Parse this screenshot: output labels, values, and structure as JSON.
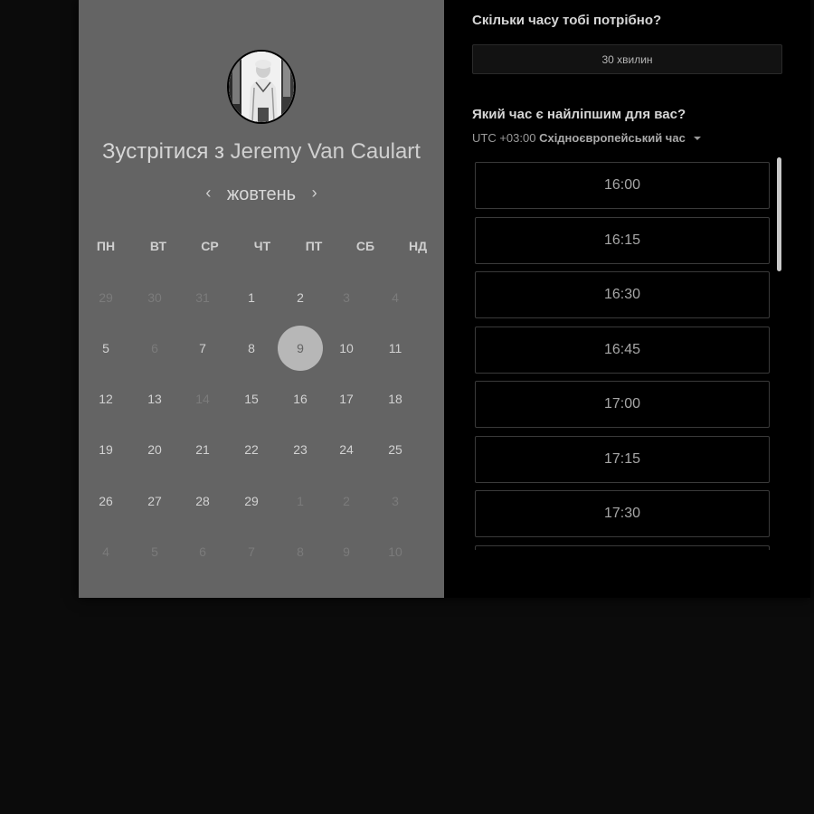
{
  "calendar": {
    "title_prefix": "Зустрітися з",
    "host_name": "Jeremy Van Caulart",
    "month": "жовтень",
    "prev_icon": "‹",
    "next_icon": "›",
    "weekdays": [
      "ПН",
      "ВТ",
      "СР",
      "ЧТ",
      "ПТ",
      "СБ",
      "НД"
    ],
    "weeks": [
      [
        {
          "d": "29",
          "m": true
        },
        {
          "d": "30",
          "m": true
        },
        {
          "d": "31",
          "m": true
        },
        {
          "d": "1",
          "m": false
        },
        {
          "d": "2",
          "m": false
        },
        {
          "d": "3",
          "m": true
        },
        {
          "d": "4",
          "m": true
        }
      ],
      [
        {
          "d": "5",
          "m": false
        },
        {
          "d": "6",
          "m": true
        },
        {
          "d": "7",
          "m": false
        },
        {
          "d": "8",
          "m": false
        },
        {
          "d": "9",
          "m": false,
          "sel": true
        },
        {
          "d": "10",
          "m": false
        },
        {
          "d": "11",
          "m": false
        }
      ],
      [
        {
          "d": "12",
          "m": false
        },
        {
          "d": "13",
          "m": false
        },
        {
          "d": "14",
          "m": true
        },
        {
          "d": "15",
          "m": false
        },
        {
          "d": "16",
          "m": false
        },
        {
          "d": "17",
          "m": false
        },
        {
          "d": "18",
          "m": false
        }
      ],
      [
        {
          "d": "19",
          "m": false
        },
        {
          "d": "20",
          "m": false
        },
        {
          "d": "21",
          "m": false
        },
        {
          "d": "22",
          "m": false
        },
        {
          "d": "23",
          "m": false
        },
        {
          "d": "24",
          "m": false
        },
        {
          "d": "25",
          "m": false
        }
      ],
      [
        {
          "d": "26",
          "m": false
        },
        {
          "d": "27",
          "m": false
        },
        {
          "d": "28",
          "m": false
        },
        {
          "d": "29",
          "m": false
        },
        {
          "d": "1",
          "m": true
        },
        {
          "d": "2",
          "m": true
        },
        {
          "d": "3",
          "m": true
        }
      ],
      [
        {
          "d": "4",
          "m": true
        },
        {
          "d": "5",
          "m": true
        },
        {
          "d": "6",
          "m": true
        },
        {
          "d": "7",
          "m": true
        },
        {
          "d": "8",
          "m": true
        },
        {
          "d": "9",
          "m": true
        },
        {
          "d": "10",
          "m": true
        }
      ]
    ]
  },
  "booking": {
    "duration_question": "Скільки часу тобі потрібно?",
    "duration_value": "30 хвилин",
    "time_question": "Який час є найліпшим для вас?",
    "timezone_offset": "UTC +03:00",
    "timezone_name": "Східноєвропейський час",
    "slots": [
      "16:00",
      "16:15",
      "16:30",
      "16:45",
      "17:00",
      "17:15",
      "17:30",
      ""
    ]
  },
  "colors": {
    "left_panel": "#646464",
    "right_panel": "#000000",
    "selected_day": "#b7b7b7"
  }
}
